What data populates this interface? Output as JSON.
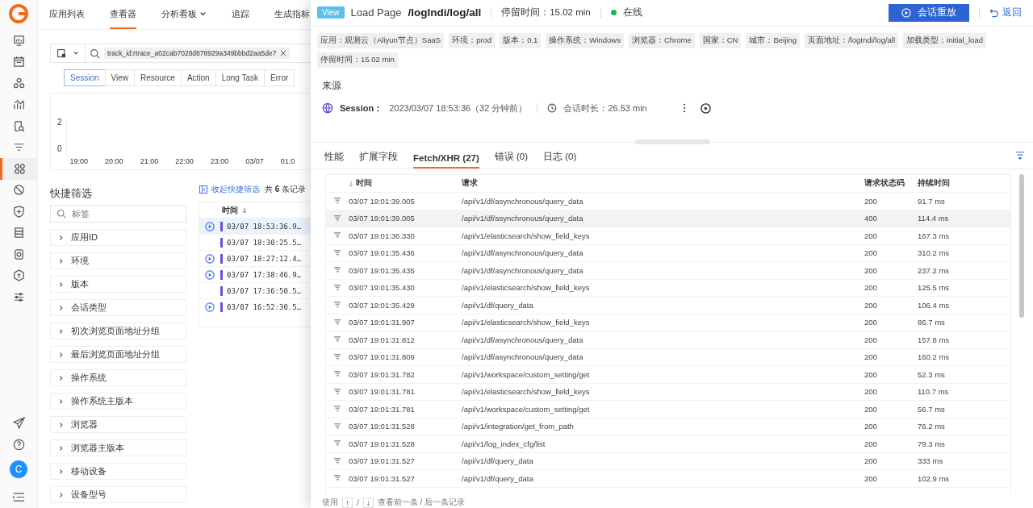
{
  "nav": {
    "top_icons": [
      {
        "kind": "monitor",
        "selected": false
      },
      {
        "kind": "calendar",
        "selected": false
      },
      {
        "kind": "nodes",
        "selected": false
      },
      {
        "kind": "chart",
        "selected": false
      },
      {
        "kind": "search-doc",
        "selected": false
      },
      {
        "kind": "filter",
        "selected": false
      },
      {
        "kind": "grid",
        "selected": true
      },
      {
        "kind": "blocked",
        "selected": false
      },
      {
        "kind": "shield",
        "selected": false
      },
      {
        "kind": "server",
        "selected": false
      },
      {
        "kind": "camera",
        "selected": false
      },
      {
        "kind": "hexagon",
        "selected": false
      },
      {
        "kind": "sliders",
        "selected": false
      }
    ],
    "avatar": "C"
  },
  "top_tabs": [
    {
      "label": "应用列表",
      "selected": false,
      "dropdown": false
    },
    {
      "label": "查看器",
      "selected": true,
      "dropdown": false
    },
    {
      "label": "分析看板",
      "selected": false,
      "dropdown": true
    },
    {
      "label": "追踪",
      "selected": false,
      "dropdown": false
    },
    {
      "label": "生成指标",
      "selected": false,
      "dropdown": false
    }
  ],
  "search": {
    "value": "track_id:rtrace_a02cab7028d878929a349bbbd2aa5de7"
  },
  "type_tabs": [
    {
      "label": "Session",
      "selected": true
    },
    {
      "label": "View",
      "selected": false
    },
    {
      "label": "Resource",
      "selected": false
    },
    {
      "label": "Action",
      "selected": false
    },
    {
      "label": "Long Task",
      "selected": false
    },
    {
      "label": "Error",
      "selected": false
    }
  ],
  "chart_axis": {
    "y_labels": [
      "2",
      "0"
    ],
    "x_labels": [
      "19:00",
      "20:00",
      "21:00",
      "22:00",
      "23:00",
      "03/07",
      "01:0"
    ]
  },
  "quick_filter": {
    "title": "快捷筛选",
    "placeholder": "标签",
    "items": [
      "应用ID",
      "环境",
      "版本",
      "会话类型",
      "初次浏览页面地址分组",
      "最后浏览页面地址分组",
      "操作系统",
      "操作系统主版本",
      "浏览器",
      "浏览器主版本",
      "移动设备",
      "设备型号"
    ]
  },
  "list": {
    "collapse_link": "收起快捷筛选",
    "count": "共 **6** 条记录",
    "column": "时间",
    "rows": [
      {
        "time": "03/07 18:53:36.9…",
        "replay": true,
        "selected": true
      },
      {
        "time": "03/07 18:30:25.5…",
        "replay": false,
        "selected": false
      },
      {
        "time": "03/07 18:27:12.4…",
        "replay": true,
        "selected": false
      },
      {
        "time": "03/07 17:38:46.9…",
        "replay": true,
        "selected": false
      },
      {
        "time": "03/07 17:36:50.5…",
        "replay": false,
        "selected": false
      },
      {
        "time": "03/07 16:52:30.5…",
        "replay": true,
        "selected": false
      }
    ]
  },
  "drawer": {
    "badge": "View",
    "event": "Load Page",
    "path": "/logIndi/log/all",
    "stay": "停留时间：15.02 min",
    "online": true,
    "status": "在线",
    "replay_button": "会话重放",
    "back": "返回",
    "tags": [
      "应用：观测云（Aliyun节点）SaaS",
      "环境：prod",
      "版本：0.1",
      "操作系统：Windows",
      "浏览器：Chrome",
      "国家：CN",
      "城市：Beijing",
      "页面地址：/logIndi/log/all",
      "加载类型：initial_load",
      "停留时间：15.02 min"
    ],
    "source_title": "来源",
    "session_label": "Session：",
    "session_time": "2023/03/07 18:53:36（32 分钟前）",
    "duration": "会话时长：26.53 min",
    "tabs": [
      {
        "label": "性能",
        "selected": false
      },
      {
        "label": "扩展字段",
        "selected": false
      },
      {
        "label": "Fetch/XHR (27)",
        "selected": true
      },
      {
        "label": "错误 (0)",
        "selected": false
      },
      {
        "label": "日志 (0)",
        "selected": false
      }
    ],
    "columns": [
      "时间",
      "请求",
      "请求状态码",
      "持续时间"
    ],
    "rows": [
      {
        "time": "03/07 19:01:39.005",
        "request": "/api/v1/df/asynchronous/query_data",
        "status": "200",
        "duration": "91.7 ms",
        "highlighted": false
      },
      {
        "time": "03/07 19:01:39.005",
        "request": "/api/v1/df/asynchronous/query_data",
        "status": "400",
        "duration": "114.4 ms",
        "highlighted": true
      },
      {
        "time": "03/07 19:01:36.330",
        "request": "/api/v1/elasticsearch/show_field_keys",
        "status": "200",
        "duration": "167.3 ms",
        "highlighted": false
      },
      {
        "time": "03/07 19:01:35.436",
        "request": "/api/v1/df/asynchronous/query_data",
        "status": "200",
        "duration": "310.2 ms",
        "highlighted": false
      },
      {
        "time": "03/07 19:01:35.435",
        "request": "/api/v1/df/asynchronous/query_data",
        "status": "200",
        "duration": "237.2 ms",
        "highlighted": false
      },
      {
        "time": "03/07 19:01:35.430",
        "request": "/api/v1/elasticsearch/show_field_keys",
        "status": "200",
        "duration": "125.5 ms",
        "highlighted": false
      },
      {
        "time": "03/07 19:01:35.429",
        "request": "/api/v1/df/query_data",
        "status": "200",
        "duration": "106.4 ms",
        "highlighted": false
      },
      {
        "time": "03/07 19:01:31.907",
        "request": "/api/v1/elasticsearch/show_field_keys",
        "status": "200",
        "duration": "86.7 ms",
        "highlighted": false
      },
      {
        "time": "03/07 19:01:31.812",
        "request": "/api/v1/df/asynchronous/query_data",
        "status": "200",
        "duration": "157.8 ms",
        "highlighted": false
      },
      {
        "time": "03/07 19:01:31.809",
        "request": "/api/v1/df/asynchronous/query_data",
        "status": "200",
        "duration": "160.2 ms",
        "highlighted": false
      },
      {
        "time": "03/07 19:01:31.782",
        "request": "/api/v1/workspace/custom_setting/get",
        "status": "200",
        "duration": "52.3 ms",
        "highlighted": false
      },
      {
        "time": "03/07 19:01:31.781",
        "request": "/api/v1/elasticsearch/show_field_keys",
        "status": "200",
        "duration": "110.7 ms",
        "highlighted": false
      },
      {
        "time": "03/07 19:01:31.781",
        "request": "/api/v1/workspace/custom_setting/get",
        "status": "200",
        "duration": "56.7 ms",
        "highlighted": false
      },
      {
        "time": "03/07 19:01:31.528",
        "request": "/api/v1/integration/get_from_path",
        "status": "200",
        "duration": "76.2 ms",
        "highlighted": false
      },
      {
        "time": "03/07 19:01:31.528",
        "request": "/api/v1/log_index_cfg/list",
        "status": "200",
        "duration": "79.3 ms",
        "highlighted": false
      },
      {
        "time": "03/07 19:01:31.527",
        "request": "/api/v1/df/query_data",
        "status": "200",
        "duration": "333 ms",
        "highlighted": false
      },
      {
        "time": "03/07 19:01:31.527",
        "request": "/api/v1/df/query_data",
        "status": "200",
        "duration": "102.9 ms",
        "highlighted": false
      }
    ],
    "footer": {
      "prefix": "使用",
      "key_up": "↑",
      "sep": "/",
      "key_down": "↓",
      "suffix": "查看前一条 / 后一条记录"
    }
  }
}
